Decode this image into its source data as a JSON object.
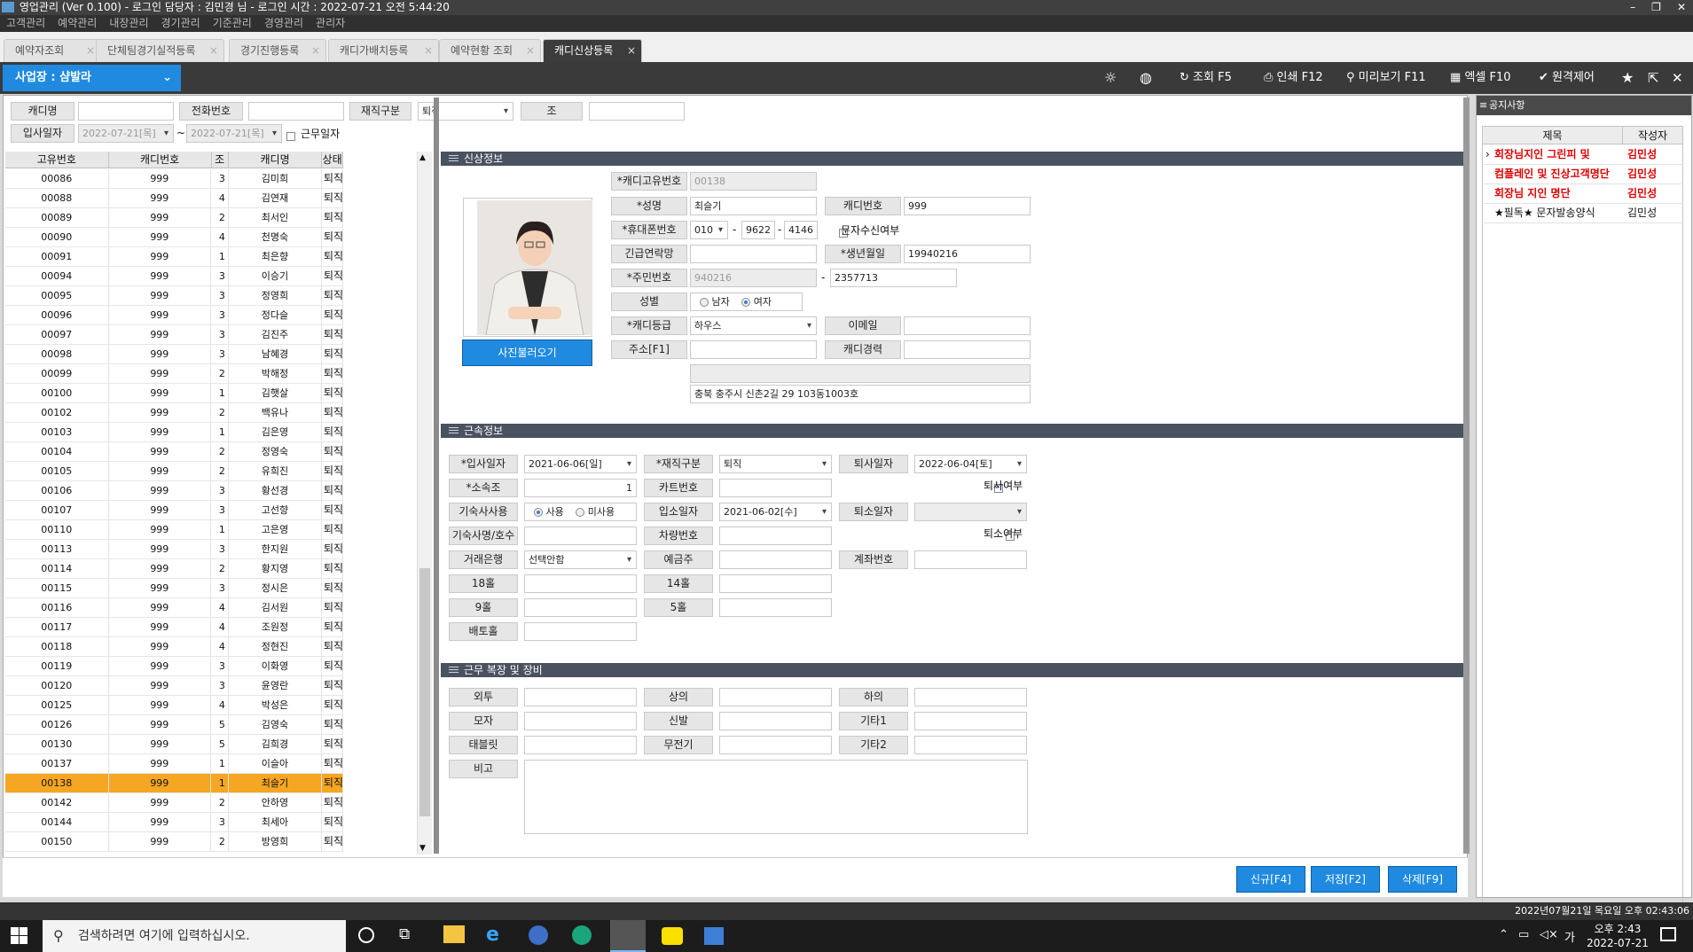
{
  "title_bar": {
    "text": "영업관리 (Ver 0.100)   - 로그인 담당자 : 김민경 님   - 로그인 시간 : 2022-07-21 오전 5:44:20",
    "controls": [
      "–",
      "❐",
      "✕"
    ]
  },
  "menu": [
    "고객관리",
    "예약관리",
    "내장관리",
    "경기관리",
    "기준관리",
    "경영관리",
    "관리자"
  ],
  "tabs": [
    "예약자조회",
    "단체팀경기실적등록",
    "경기진행등록",
    "캐디가배치등록",
    "예약현황 조회",
    "캐디신상등록"
  ],
  "active_tab": 5,
  "toolbar": {
    "business_label": "사업장 : 샴발라",
    "buttons": {
      "search": "조회 F5",
      "print": "인쇄 F12",
      "preview": "미리보기 F11",
      "excel": "엑셀 F10",
      "remote": "원격제어"
    }
  },
  "search": {
    "caddy_name_label": "캐디명",
    "caddy_name_value": "",
    "phone_label": "전화번호",
    "phone_value": "",
    "status_label": "재직구분",
    "status_value": "퇴직",
    "group_label": "조",
    "group_value": "",
    "join_date_label": "입사일자",
    "date_from": "2022-07-21[목]",
    "date_sep": "~",
    "date_to": "2022-07-21[목]",
    "work_date_label": "근무일자"
  },
  "grid": {
    "columns": [
      "고유번호",
      "캐디번호",
      "조",
      "캐디명",
      "상태"
    ],
    "rows": [
      [
        "00086",
        "999",
        "3",
        "김미희",
        "퇴직"
      ],
      [
        "00088",
        "999",
        "4",
        "김연재",
        "퇴직"
      ],
      [
        "00089",
        "999",
        "2",
        "최서인",
        "퇴직"
      ],
      [
        "00090",
        "999",
        "4",
        "천명숙",
        "퇴직"
      ],
      [
        "00091",
        "999",
        "1",
        "최은향",
        "퇴직"
      ],
      [
        "00094",
        "999",
        "3",
        "이승기",
        "퇴직"
      ],
      [
        "00095",
        "999",
        "3",
        "정영희",
        "퇴직"
      ],
      [
        "00096",
        "999",
        "3",
        "정다슬",
        "퇴직"
      ],
      [
        "00097",
        "999",
        "3",
        "김진주",
        "퇴직"
      ],
      [
        "00098",
        "999",
        "3",
        "남혜경",
        "퇴직"
      ],
      [
        "00099",
        "999",
        "2",
        "박해정",
        "퇴직"
      ],
      [
        "00100",
        "999",
        "1",
        "김햇살",
        "퇴직"
      ],
      [
        "00102",
        "999",
        "2",
        "백유나",
        "퇴직"
      ],
      [
        "00103",
        "999",
        "1",
        "김은영",
        "퇴직"
      ],
      [
        "00104",
        "999",
        "2",
        "정영숙",
        "퇴직"
      ],
      [
        "00105",
        "999",
        "2",
        "유희진",
        "퇴직"
      ],
      [
        "00106",
        "999",
        "3",
        "황선경",
        "퇴직"
      ],
      [
        "00107",
        "999",
        "3",
        "고선향",
        "퇴직"
      ],
      [
        "00110",
        "999",
        "1",
        "고은영",
        "퇴직"
      ],
      [
        "00113",
        "999",
        "3",
        "한지원",
        "퇴직"
      ],
      [
        "00114",
        "999",
        "2",
        "황지영",
        "퇴직"
      ],
      [
        "00115",
        "999",
        "3",
        "정시은",
        "퇴직"
      ],
      [
        "00116",
        "999",
        "4",
        "김서원",
        "퇴직"
      ],
      [
        "00117",
        "999",
        "4",
        "조원정",
        "퇴직"
      ],
      [
        "00118",
        "999",
        "4",
        "정현진",
        "퇴직"
      ],
      [
        "00119",
        "999",
        "3",
        "이화영",
        "퇴직"
      ],
      [
        "00120",
        "999",
        "3",
        "윤영란",
        "퇴직"
      ],
      [
        "00125",
        "999",
        "4",
        "박성은",
        "퇴직"
      ],
      [
        "00126",
        "999",
        "5",
        "김영숙",
        "퇴직"
      ],
      [
        "00130",
        "999",
        "5",
        "김희경",
        "퇴직"
      ],
      [
        "00137",
        "999",
        "1",
        "이슬아",
        "퇴직"
      ],
      [
        "00138",
        "999",
        "1",
        "최슬기",
        "퇴직"
      ],
      [
        "00142",
        "999",
        "2",
        "안하영",
        "퇴직"
      ],
      [
        "00144",
        "999",
        "3",
        "최세아",
        "퇴직"
      ],
      [
        "00150",
        "999",
        "2",
        "방영희",
        "퇴직"
      ]
    ],
    "selected_index": 31
  },
  "personal": {
    "section_title": "신상정보",
    "photo_button": "사진불러오기",
    "caddy_id_label": "*캐디고유번호",
    "caddy_id_value": "00138",
    "name_label": "*성명",
    "name_value": "최슬기",
    "caddy_no_label": "캐디번호",
    "caddy_no_value": "999",
    "mobile_label": "*휴대폰번호",
    "mobile_1": "010",
    "mobile_sep": "-",
    "mobile_2": "9622",
    "mobile_3": "4146",
    "sms_label": "문자수신여부",
    "emergency_label": "긴급연락망",
    "emergency_value": "",
    "birth_label": "*생년월일",
    "birth_value": "19940216",
    "rrn_label": "*주민번호",
    "rrn_1": "940216",
    "rrn_2": "2357713",
    "gender_label": "성별",
    "male": "남자",
    "female": "여자",
    "grade_label": "*캐디등급",
    "grade_value": "하우스",
    "email_label": "이메일",
    "email_value": "",
    "address_label": "주소[F1]",
    "address_zip": "",
    "career_label": "캐디경력",
    "career_value": "",
    "address_line1": "",
    "address_line2": "충북 충주시 신촌2길 29 103동1003호"
  },
  "employment": {
    "section_title": "근속정보",
    "join_label": "*입사일자",
    "join_value": "2021-06-06[일]",
    "status_label": "*재직구분",
    "status_value": "퇴직",
    "leave_label": "퇴사일자",
    "leave_value": "2022-06-04[토]",
    "retired_label": "퇴사여부",
    "team_label": "*소속조",
    "team_value": "1",
    "cart_label": "카트번호",
    "cart_value": "",
    "dorm_label": "기숙사사용",
    "dorm_use": "사용",
    "dorm_nouse": "미사용",
    "dorm_in_label": "입소일자",
    "dorm_in_value": "2021-06-02[수]",
    "dorm_out_label": "퇴소일자",
    "dorm_out_value": "",
    "dorm_name_label": "기숙사명/호수",
    "dorm_name_value": "",
    "car_label": "차량번호",
    "car_value": "",
    "out_check_label": "퇴소여부",
    "bank_label": "거래은행",
    "bank_value": "선택안함",
    "holder_label": "예금주",
    "holder_value": "",
    "account_label": "계좌번호",
    "account_value": "",
    "h18_label": "18홀",
    "h14_label": "14홀",
    "h9_label": "9홀",
    "h5_label": "5홀",
    "h_baeto_label": "배토홀"
  },
  "equipment": {
    "section_title": "근무 복장 및 장비",
    "outer": "외투",
    "top": "상의",
    "bottom": "하의",
    "hat": "모자",
    "shoes": "신발",
    "etc1": "기타1",
    "tablet": "태블릿",
    "radio": "무전기",
    "etc2": "기타2",
    "memo": "비고"
  },
  "actions": {
    "new": "신규[F4]",
    "save": "저장[F2]",
    "delete": "삭제[F9]"
  },
  "notice": {
    "panel_title": "공지사항",
    "columns": [
      "제목",
      "작성자"
    ],
    "rows": [
      {
        "title": "회장님지인 그린피 및",
        "author": "김민성",
        "color": "#e00000"
      },
      {
        "title": "컴플레인 및 진상고객명단",
        "author": "김민성",
        "color": "#e00000"
      },
      {
        "title": "회장님 지인 명단",
        "author": "김민성",
        "color": "#e00000"
      },
      {
        "title": "★필독★ 문자발송양식",
        "author": "김민성",
        "color": "#111111"
      }
    ]
  },
  "statusbar": {
    "datetime": "2022년07월21일 목요일 오후 02:43:06"
  },
  "taskbar": {
    "search_placeholder": "검색하려면 여기에 입력하십시오.",
    "ime": "가",
    "time": "오후 2:43",
    "date": "2022-07-21"
  },
  "colors": {
    "accent": "#1f8ae0",
    "selected_row": "#f5a623",
    "section_header": "#4a5160",
    "notice_red": "#e00000"
  }
}
